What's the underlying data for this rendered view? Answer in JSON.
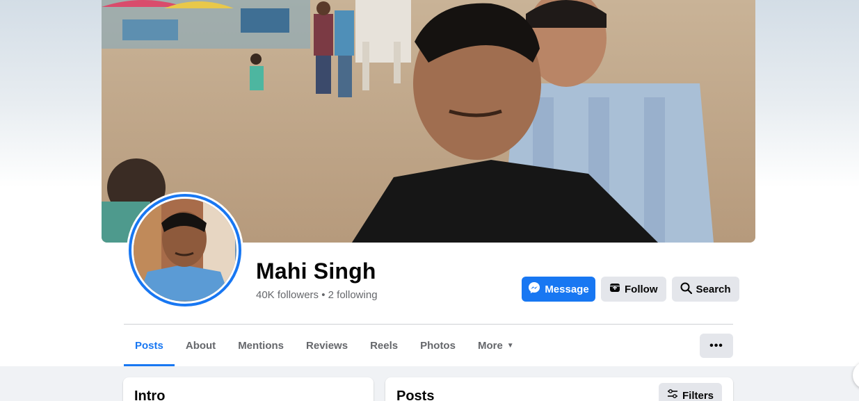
{
  "profile": {
    "name": "Mahi Singh",
    "followers": "40K followers",
    "separator": "•",
    "following": "2 following"
  },
  "actions": {
    "message_label": "Message",
    "follow_label": "Follow",
    "search_label": "Search"
  },
  "tabs": [
    {
      "label": "Posts",
      "active": true
    },
    {
      "label": "About",
      "active": false
    },
    {
      "label": "Mentions",
      "active": false
    },
    {
      "label": "Reviews",
      "active": false
    },
    {
      "label": "Reels",
      "active": false
    },
    {
      "label": "Photos",
      "active": false
    },
    {
      "label": "More",
      "active": false
    }
  ],
  "cards": {
    "intro_title": "Intro",
    "posts_title": "Posts",
    "filters_label": "Filters"
  },
  "icons": {
    "message": "messenger-icon",
    "follow": "follow-icon",
    "search": "search-icon",
    "more": "caret-down-icon",
    "dots": "more-dots-icon",
    "filters": "filters-icon"
  },
  "colors": {
    "accent": "#1877f2",
    "secondary_button": "#e4e6eb",
    "muted_text": "#65676b"
  }
}
